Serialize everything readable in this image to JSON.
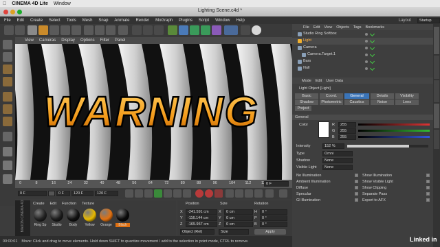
{
  "mac_menu": {
    "app": "CINEMA 4D Lite",
    "window": "Window"
  },
  "window_title": "Lighting Scene.c4d *",
  "menus": [
    "File",
    "Edit",
    "Create",
    "Select",
    "Tools",
    "Mesh",
    "Snap",
    "Animate",
    "Render",
    "MoGraph",
    "Plugins",
    "Script",
    "Window",
    "Help"
  ],
  "layout_label": "Layout",
  "layout_value": "Startup",
  "viewport": {
    "menu": [
      "View",
      "Cameras",
      "Display",
      "Options",
      "Filter",
      "Panel"
    ],
    "headline": "WARNING"
  },
  "timeline": {
    "ticks": [
      "0",
      "8",
      "16",
      "24",
      "32",
      "40",
      "48",
      "56",
      "64",
      "72",
      "80",
      "88",
      "96",
      "104",
      "112",
      "120"
    ],
    "current_frame": "0 F"
  },
  "transport": {
    "start": "0 F",
    "current": "0 F",
    "end": "120 F",
    "max": "120 F"
  },
  "materials": {
    "menu": [
      "Create",
      "Edit",
      "Function",
      "Texture"
    ],
    "items": [
      {
        "name": "Ring Sp",
        "color": "#222222"
      },
      {
        "name": "Studio",
        "color": "#1c1c1c"
      },
      {
        "name": "Body",
        "color": "#111111"
      },
      {
        "name": "Yellow",
        "color": "#e6b800"
      },
      {
        "name": "Orange",
        "color": "#e07010"
      },
      {
        "name": "Black",
        "color": "#0a0a0a"
      }
    ],
    "selected": "Black",
    "logo": "MAXON CINEMA 4D"
  },
  "coordinates": {
    "headers": [
      "Position",
      "Size",
      "Rotation"
    ],
    "rows": [
      {
        "axis": "X",
        "pos": "-241.591 cm",
        "saxis": "X",
        "size": "0 cm",
        "raxis": "H",
        "rot": "0 °"
      },
      {
        "axis": "Y",
        "pos": "-116.144 cm",
        "saxis": "Y",
        "size": "0 cm",
        "raxis": "P",
        "rot": "0 °"
      },
      {
        "axis": "Z",
        "pos": "-165.957 cm",
        "saxis": "Z",
        "size": "0 cm",
        "raxis": "B",
        "rot": "0 °"
      }
    ],
    "mode": "Object (Rel)",
    "size_mode": "Size",
    "apply": "Apply"
  },
  "status": {
    "time": "00:00:01",
    "text": "Move: Click and drag to move elements. Hold down SHIFT to quantize movement / add to the selection in point mode, CTRL to remove."
  },
  "object_manager": {
    "menu": [
      "File",
      "Edit",
      "View",
      "Objects",
      "Tags",
      "Bookmarks"
    ],
    "objects": [
      {
        "name": "Studio Ring Softbox",
        "active": false
      },
      {
        "name": "Light",
        "active": true
      },
      {
        "name": "Camera",
        "active": false
      },
      {
        "name": "Camera.Target.1",
        "active": false
      },
      {
        "name": "Bars",
        "active": false
      },
      {
        "name": "Null",
        "active": false
      }
    ]
  },
  "attributes": {
    "menu": [
      "Mode",
      "Edit",
      "User Data"
    ],
    "title": "Light Object [Light]",
    "tabs_row1": [
      "Basic",
      "Coord.",
      "General",
      "Details",
      "Visibility"
    ],
    "tabs_row2": [
      "Shadow",
      "Photometric",
      "Caustics",
      "Noise",
      "Lens"
    ],
    "tabs_row3": [
      "Project"
    ],
    "active_tab": "General",
    "section": "General",
    "color_label": "Color",
    "rgb": [
      {
        "ch": "R",
        "val": "255"
      },
      {
        "ch": "G",
        "val": "255"
      },
      {
        "ch": "B",
        "val": "255"
      }
    ],
    "intensity_label": "Intensity",
    "intensity": "152 %",
    "type_label": "Type",
    "type": "Omni",
    "shadow_label": "Shadow",
    "shadow": "None",
    "visible_light_label": "Visible Light",
    "visible_light": "None",
    "checks_left": [
      "No Illumination",
      "Ambient Illumination",
      "Diffuse",
      "Specular",
      "GI Illumination"
    ],
    "checks_right": [
      "Show Illumination",
      "Show Visible Light",
      "Show Clipping",
      "Separate Pass",
      "Export to AFX"
    ]
  },
  "right_tabs": [
    "Objects",
    "Content Browser",
    "Structure",
    "Attributes",
    "Layers"
  ],
  "watermark": "Linked in"
}
